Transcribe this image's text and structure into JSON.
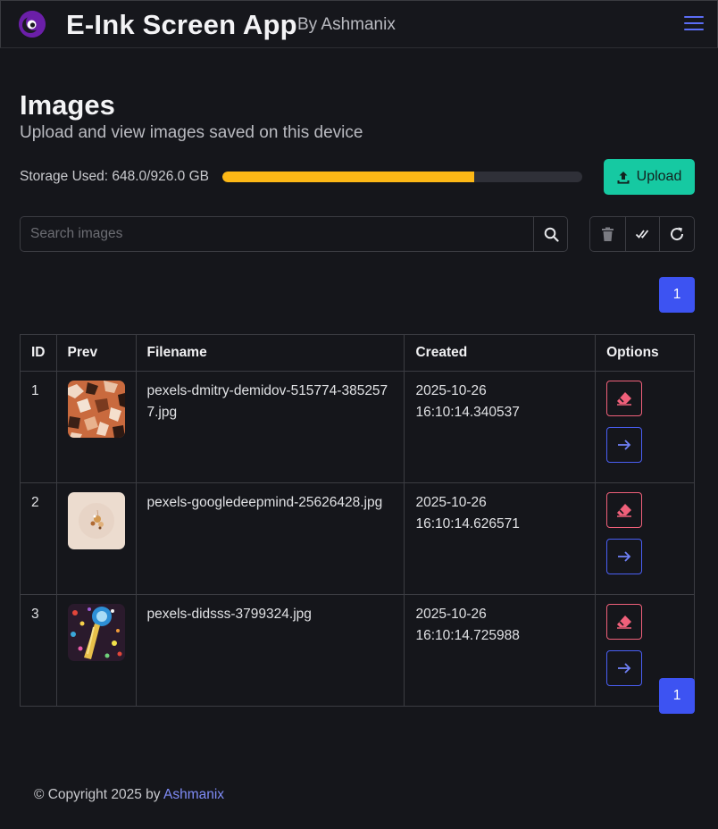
{
  "header": {
    "title": "E-Ink Screen App",
    "subtitle": "By Ashmanix",
    "logo_icon": "moon-eye-logo-icon",
    "menu_icon": "hamburger-menu-icon"
  },
  "page": {
    "title": "Images",
    "subtitle": "Upload and view images saved on this device"
  },
  "storage": {
    "label": "Storage Used: 648.0/926.0 GB",
    "used": 648.0,
    "total": 926.0,
    "fill_color": "#fdb816"
  },
  "toolbar": {
    "upload_label": "Upload",
    "search_placeholder": "Search images",
    "search_value": "",
    "delete_icon": "trash-icon",
    "select_icon": "double-check-icon",
    "refresh_icon": "refresh-icon"
  },
  "pagination": {
    "top_page": "1",
    "bottom_page": "1"
  },
  "table": {
    "columns": [
      "ID",
      "Prev",
      "Filename",
      "Created",
      "Options"
    ],
    "rows": [
      {
        "id": "1",
        "filename": "pexels-dmitry-demidov-515774-3852577.jpg",
        "created": "2025-10-26 16:10:14.340537"
      },
      {
        "id": "2",
        "filename": "pexels-googledeepmind-25626428.jpg",
        "created": "2025-10-26 16:10:14.626571"
      },
      {
        "id": "3",
        "filename": "pexels-didsss-3799324.jpg",
        "created": "2025-10-26 16:10:14.725988"
      }
    ]
  },
  "footer": {
    "text": "© Copyright 2025 by",
    "link": "Ashmanix"
  },
  "colors": {
    "background": "#15161b",
    "accent": "#3d53f2",
    "upload": "#16c9a2",
    "danger": "#f0607a"
  }
}
